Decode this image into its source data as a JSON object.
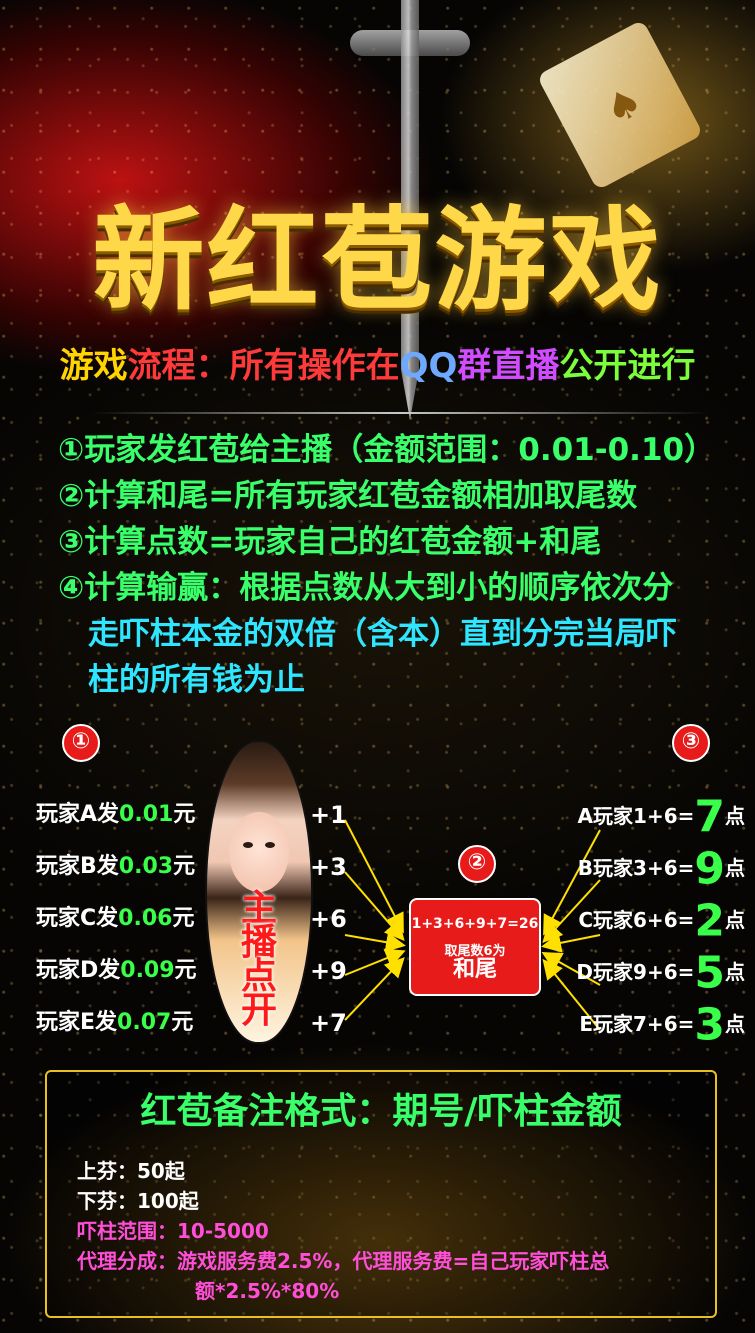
{
  "title": "新红苞游戏",
  "flow": {
    "part1": "游戏",
    "part2": "流程：",
    "part3": "所有操作在",
    "part4": "QQ",
    "part5": "群直播",
    "part6": "公开进行"
  },
  "rules": [
    "①玩家发红苞给主播（金额范围：0.01-0.10）",
    "②计算和尾=所有玩家红苞金额相加取尾数",
    "③计算点数=玩家自己的红苞金额+和尾",
    "④计算输赢：根据点数从大到小的顺序依次分"
  ],
  "rule4_cont": [
    "走吓柱本金的双倍（含本）直到分完当局吓",
    "柱的所有钱为止"
  ],
  "step_labels": [
    "①",
    "②",
    "③"
  ],
  "players": [
    {
      "label": "玩家A发",
      "amount": "0.01",
      "unit": "元",
      "add": "+1"
    },
    {
      "label": "玩家B发",
      "amount": "0.03",
      "unit": "元",
      "add": "+3"
    },
    {
      "label": "玩家C发",
      "amount": "0.06",
      "unit": "元",
      "add": "+6"
    },
    {
      "label": "玩家D发",
      "amount": "0.09",
      "unit": "元",
      "add": "+9"
    },
    {
      "label": "玩家E发",
      "amount": "0.07",
      "unit": "元",
      "add": "+7"
    }
  ],
  "host_text": "主播点开",
  "center": {
    "equation": "1+3+6+9+7=26",
    "sub": "取尾数6为",
    "big": "和尾"
  },
  "results": [
    {
      "label": "A玩家1+6=",
      "points": "7",
      "unit": "点"
    },
    {
      "label": "B玩家3+6=",
      "points": "9",
      "unit": "点"
    },
    {
      "label": "C玩家6+6=",
      "points": "2",
      "unit": "点"
    },
    {
      "label": "D玩家9+6=",
      "points": "5",
      "unit": "点"
    },
    {
      "label": "E玩家7+6=",
      "points": "3",
      "unit": "点"
    }
  ],
  "note": {
    "title": "红苞备注格式：期号/吓柱金额",
    "up": "上芬：50起",
    "down": "下芬：100起",
    "range": "吓柱范围：10-5000",
    "agent": "代理分成：游戏服务费2.5%，代理服务费=自己玩家吓柱总",
    "agent_cont": "额*2.5%*80%"
  },
  "colors": {
    "gold": "#ffd84a",
    "red": "#e81b1b",
    "green": "#39ff4a",
    "cyan": "#2ee6ff",
    "pink": "#ff4fd8",
    "border": "#e8c020"
  }
}
